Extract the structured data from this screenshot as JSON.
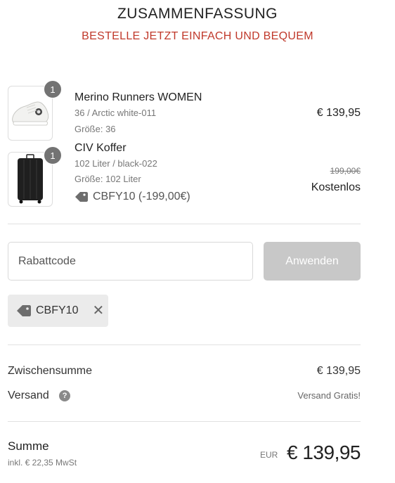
{
  "header": {
    "title": "ZUSAMMENFASSUNG",
    "subtitle": "BESTELLE JETZT EINFACH UND BEQUEM"
  },
  "items": [
    {
      "quantity": "1",
      "name": "Merino Runners WOMEN",
      "variant": "36 / Arctic white-011",
      "size": "Größe: 36",
      "price": "€ 139,95",
      "image": "white-sneaker"
    },
    {
      "quantity": "1",
      "name": "CIV Koffer",
      "variant": "102 Liter / black-022",
      "size": "Größe: 102 Liter",
      "discount_code": "CBFY10 (-199,00€)",
      "original_price": "199,00€",
      "price": "Kostenlos",
      "image": "black-suitcase"
    }
  ],
  "coupon": {
    "placeholder": "Rabattcode",
    "apply_label": "Anwenden",
    "applied_code": "CBFY10"
  },
  "totals": {
    "subtotal_label": "Zwischensumme",
    "subtotal_value": "€ 139,95",
    "shipping_label": "Versand",
    "shipping_help": "?",
    "shipping_value": "Versand Gratis!",
    "total_label": "Summe",
    "tax_note": "inkl. € 22,35 MwSt",
    "currency": "EUR",
    "total_value": "€ 139,95"
  },
  "colors": {
    "accent_red": "#c0392b",
    "button_disabled": "#c8c8c8",
    "badge": "#737373"
  }
}
